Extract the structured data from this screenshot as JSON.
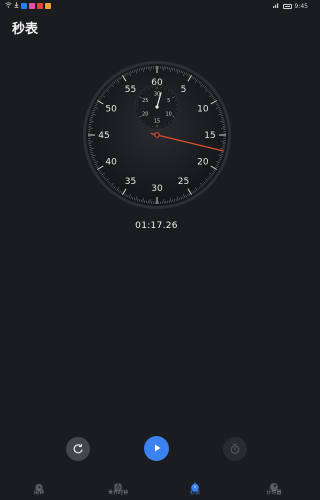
{
  "status_bar": {
    "time": "9:45",
    "icons": [
      "wifi-icon",
      "download-icon",
      "app-icon-blue",
      "app-icon-pink",
      "app-icon-red",
      "app-icon-orange"
    ],
    "right_icons": [
      "signal-icon",
      "battery-icon"
    ]
  },
  "header": {
    "title": "秒表"
  },
  "stopwatch": {
    "elapsed": "01:17.26",
    "main_dial_labels": [
      "60",
      "5",
      "10",
      "15",
      "20",
      "25",
      "30",
      "35",
      "40",
      "45",
      "50",
      "55"
    ],
    "sub_dial_labels": [
      "30",
      "5",
      "10",
      "15",
      "20",
      "25"
    ],
    "second_hand_seconds": 17.26,
    "minute_hand_minutes": 1.3
  },
  "controls": {
    "reset_icon": "reset-icon",
    "play_icon": "play-icon",
    "lap_icon": "lap-timer-icon"
  },
  "bottom_nav": [
    {
      "label": "闹钟",
      "icon": "alarm-icon",
      "active": false
    },
    {
      "label": "世界时钟",
      "icon": "globe-icon",
      "active": false
    },
    {
      "label": "秒表",
      "icon": "stopwatch-icon",
      "active": true
    },
    {
      "label": "计时器",
      "icon": "timer-icon",
      "active": false
    }
  ],
  "colors": {
    "background": "#1b1c20",
    "accent": "#3b82f0",
    "second_hand": "#e8552c"
  }
}
